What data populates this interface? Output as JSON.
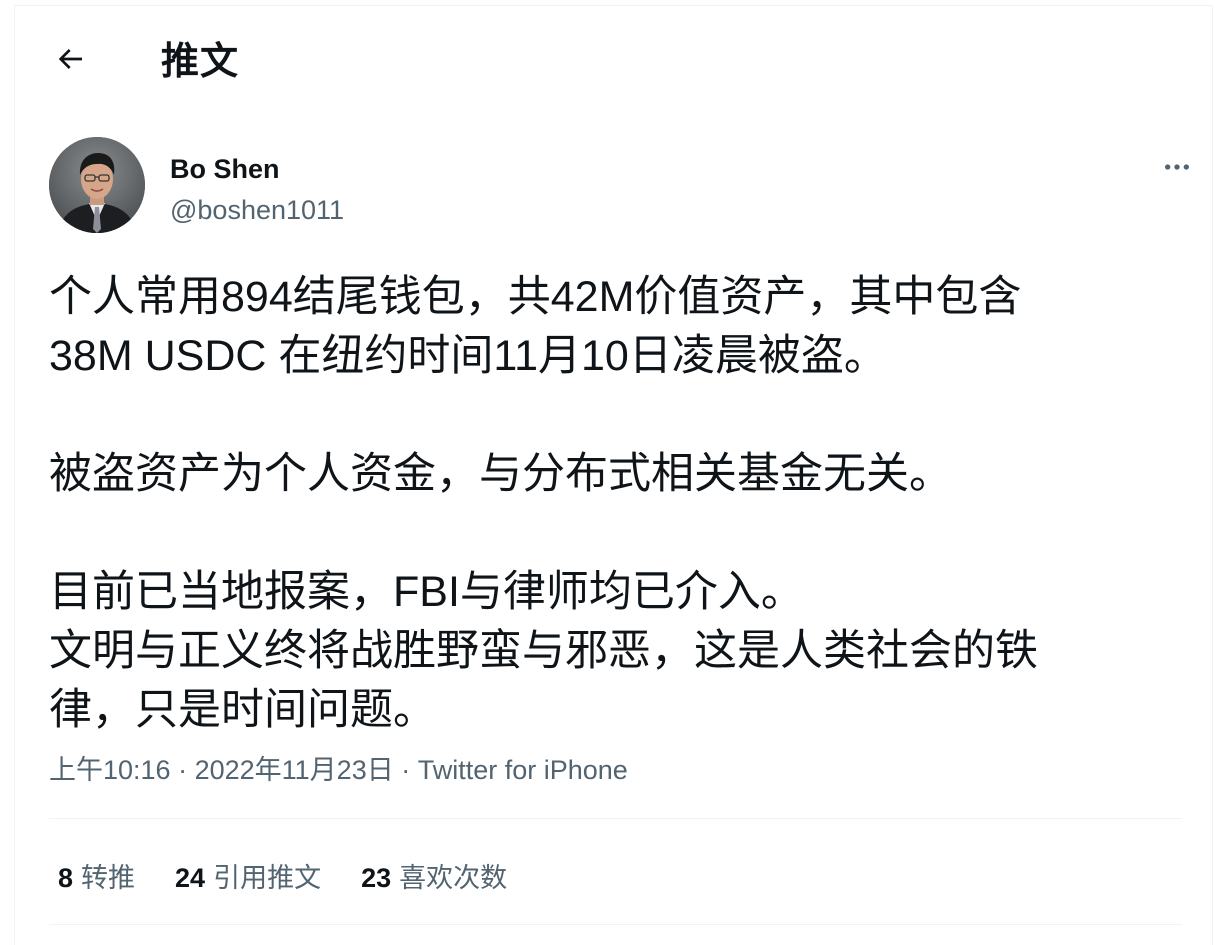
{
  "header": {
    "back_icon": "arrow-left-icon",
    "title": "推文"
  },
  "author": {
    "display_name": "Bo Shen",
    "handle": "@boshen1011",
    "more_icon": "more-horizontal-icon"
  },
  "tweet": {
    "text": "个人常用894结尾钱包，共42M价值资产，其中包含\n38M USDC 在纽约时间11月10日凌晨被盗。\n\n被盗资产为个人资金，与分布式相关基金无关。\n\n目前已当地报案，FBI与律师均已介入。\n文明与正义终将战胜野蛮与邪恶，这是人类社会的铁\n律，只是时间问题。",
    "time": "上午10:16",
    "separator": "·",
    "date": "2022年11月23日",
    "source": "Twitter for iPhone"
  },
  "stats": {
    "retweets_count": "8",
    "retweets_label": "转推",
    "quotes_count": "24",
    "quotes_label": "引用推文",
    "likes_count": "23",
    "likes_label": "喜欢次数"
  },
  "colors": {
    "text_primary": "#0f1419",
    "text_secondary": "#536471",
    "divider": "#eff3f4"
  }
}
